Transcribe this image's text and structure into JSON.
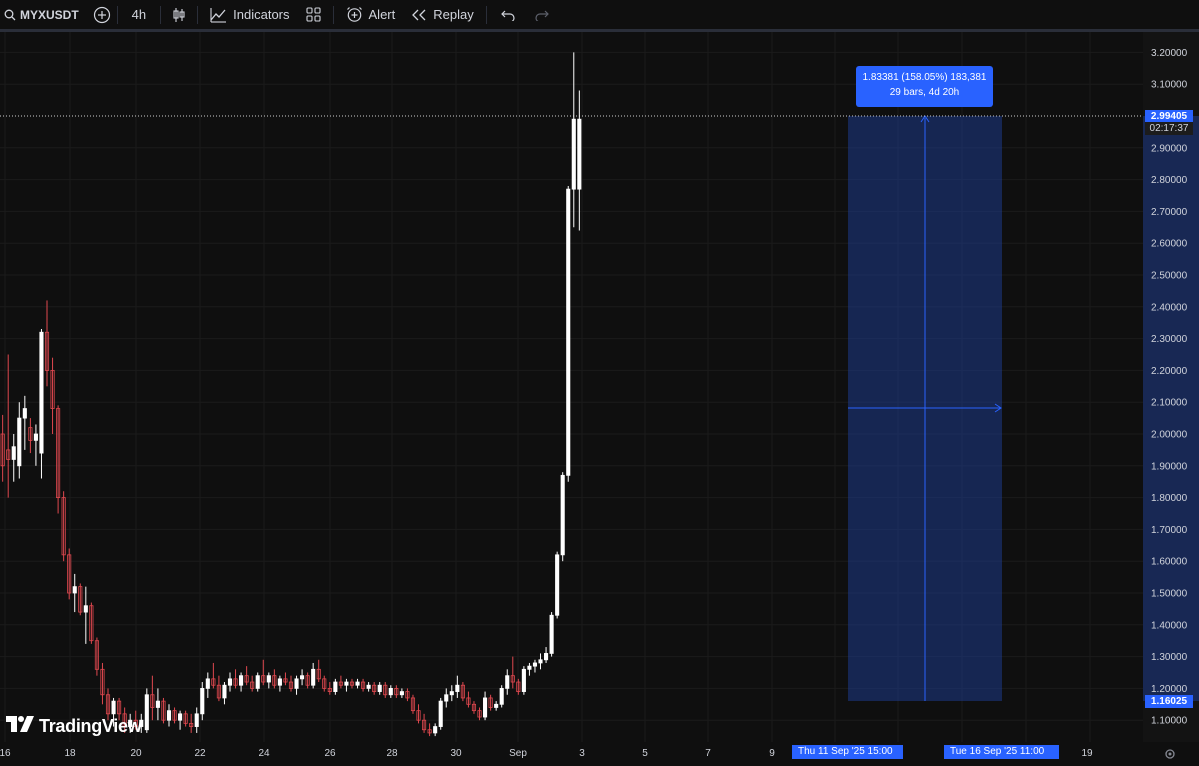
{
  "toolbar": {
    "symbol": "MYXUSDT",
    "interval": "4h",
    "indicators_label": "Indicators",
    "alert_label": "Alert",
    "replay_label": "Replay"
  },
  "colors": {
    "background": "#0f0f0f",
    "up_candle": "#ffffff",
    "down_candle": "#e0484f",
    "measure_fill": "#1e3a8a",
    "accent": "#2962ff"
  },
  "price_axis": {
    "ticks": [
      "3.20000",
      "3.10000",
      "2.90000",
      "2.80000",
      "2.70000",
      "2.60000",
      "2.50000",
      "2.40000",
      "2.30000",
      "2.20000",
      "2.10000",
      "2.00000",
      "1.90000",
      "1.80000",
      "1.70000",
      "1.60000",
      "1.50000",
      "1.40000",
      "1.30000",
      "1.20000",
      "1.10000"
    ],
    "current_price": "2.99405",
    "countdown": "02:17:37",
    "range_low_price": "1.16025"
  },
  "time_axis": {
    "ticks": [
      "16",
      "18",
      "20",
      "22",
      "24",
      "26",
      "28",
      "30",
      "Sep",
      "3",
      "5",
      "7",
      "9",
      "19"
    ],
    "start_label": "Thu 11 Sep '25   15:00",
    "end_label": "Tue 16 Sep '25   11:00"
  },
  "measurement": {
    "line1": "1.83381 (158.05%) 183,381",
    "line2": "29 bars, 4d 20h"
  },
  "branding": {
    "logo_text": "TradingView"
  },
  "chart_data": {
    "type": "candlestick",
    "interval": "4h",
    "ylim": [
      1.06,
      3.26
    ],
    "candles": [
      {
        "o": 2.0,
        "h": 2.06,
        "l": 1.85,
        "c": 1.9
      },
      {
        "o": 1.95,
        "h": 2.25,
        "l": 1.8,
        "c": 1.92
      },
      {
        "o": 1.92,
        "h": 2.0,
        "l": 1.85,
        "c": 1.96
      },
      {
        "o": 1.9,
        "h": 2.1,
        "l": 1.86,
        "c": 2.05
      },
      {
        "o": 2.05,
        "h": 2.12,
        "l": 1.95,
        "c": 2.08
      },
      {
        "o": 2.02,
        "h": 2.05,
        "l": 1.94,
        "c": 1.98
      },
      {
        "o": 1.98,
        "h": 2.03,
        "l": 1.9,
        "c": 2.0
      },
      {
        "o": 1.94,
        "h": 2.33,
        "l": 1.86,
        "c": 2.32
      },
      {
        "o": 2.32,
        "h": 2.42,
        "l": 2.15,
        "c": 2.2
      },
      {
        "o": 2.2,
        "h": 2.24,
        "l": 2.0,
        "c": 2.08
      },
      {
        "o": 2.08,
        "h": 2.09,
        "l": 1.75,
        "c": 1.8
      },
      {
        "o": 1.8,
        "h": 1.82,
        "l": 1.6,
        "c": 1.62
      },
      {
        "o": 1.62,
        "h": 1.64,
        "l": 1.48,
        "c": 1.5
      },
      {
        "o": 1.5,
        "h": 1.56,
        "l": 1.44,
        "c": 1.52
      },
      {
        "o": 1.52,
        "h": 1.53,
        "l": 1.43,
        "c": 1.44
      },
      {
        "o": 1.44,
        "h": 1.52,
        "l": 1.34,
        "c": 1.46
      },
      {
        "o": 1.46,
        "h": 1.47,
        "l": 1.34,
        "c": 1.35
      },
      {
        "o": 1.35,
        "h": 1.36,
        "l": 1.24,
        "c": 1.26
      },
      {
        "o": 1.26,
        "h": 1.28,
        "l": 1.15,
        "c": 1.18
      },
      {
        "o": 1.18,
        "h": 1.2,
        "l": 1.1,
        "c": 1.12
      },
      {
        "o": 1.12,
        "h": 1.17,
        "l": 1.08,
        "c": 1.16
      },
      {
        "o": 1.16,
        "h": 1.17,
        "l": 1.1,
        "c": 1.12
      },
      {
        "o": 1.12,
        "h": 1.14,
        "l": 1.06,
        "c": 1.08
      },
      {
        "o": 1.08,
        "h": 1.12,
        "l": 1.06,
        "c": 1.1
      },
      {
        "o": 1.1,
        "h": 1.13,
        "l": 1.07,
        "c": 1.08
      },
      {
        "o": 1.08,
        "h": 1.12,
        "l": 1.06,
        "c": 1.1
      },
      {
        "o": 1.07,
        "h": 1.2,
        "l": 1.06,
        "c": 1.18
      },
      {
        "o": 1.18,
        "h": 1.24,
        "l": 1.1,
        "c": 1.14
      },
      {
        "o": 1.14,
        "h": 1.2,
        "l": 1.1,
        "c": 1.16
      },
      {
        "o": 1.16,
        "h": 1.17,
        "l": 1.09,
        "c": 1.1
      },
      {
        "o": 1.1,
        "h": 1.15,
        "l": 1.08,
        "c": 1.13
      },
      {
        "o": 1.13,
        "h": 1.14,
        "l": 1.09,
        "c": 1.1
      },
      {
        "o": 1.1,
        "h": 1.13,
        "l": 1.07,
        "c": 1.12
      },
      {
        "o": 1.12,
        "h": 1.13,
        "l": 1.08,
        "c": 1.09
      },
      {
        "o": 1.09,
        "h": 1.12,
        "l": 1.06,
        "c": 1.08
      },
      {
        "o": 1.08,
        "h": 1.14,
        "l": 1.06,
        "c": 1.12
      },
      {
        "o": 1.12,
        "h": 1.22,
        "l": 1.1,
        "c": 1.2
      },
      {
        "o": 1.2,
        "h": 1.25,
        "l": 1.17,
        "c": 1.23
      },
      {
        "o": 1.23,
        "h": 1.28,
        "l": 1.2,
        "c": 1.21
      },
      {
        "o": 1.21,
        "h": 1.24,
        "l": 1.16,
        "c": 1.17
      },
      {
        "o": 1.17,
        "h": 1.22,
        "l": 1.15,
        "c": 1.21
      },
      {
        "o": 1.21,
        "h": 1.25,
        "l": 1.19,
        "c": 1.23
      },
      {
        "o": 1.23,
        "h": 1.26,
        "l": 1.2,
        "c": 1.21
      },
      {
        "o": 1.21,
        "h": 1.25,
        "l": 1.19,
        "c": 1.24
      },
      {
        "o": 1.24,
        "h": 1.27,
        "l": 1.21,
        "c": 1.22
      },
      {
        "o": 1.22,
        "h": 1.24,
        "l": 1.19,
        "c": 1.2
      },
      {
        "o": 1.2,
        "h": 1.25,
        "l": 1.19,
        "c": 1.24
      },
      {
        "o": 1.24,
        "h": 1.29,
        "l": 1.21,
        "c": 1.22
      },
      {
        "o": 1.22,
        "h": 1.25,
        "l": 1.2,
        "c": 1.24
      },
      {
        "o": 1.24,
        "h": 1.26,
        "l": 1.2,
        "c": 1.21
      },
      {
        "o": 1.21,
        "h": 1.24,
        "l": 1.19,
        "c": 1.23
      },
      {
        "o": 1.23,
        "h": 1.25,
        "l": 1.21,
        "c": 1.22
      },
      {
        "o": 1.22,
        "h": 1.24,
        "l": 1.19,
        "c": 1.2
      },
      {
        "o": 1.2,
        "h": 1.24,
        "l": 1.18,
        "c": 1.23
      },
      {
        "o": 1.23,
        "h": 1.26,
        "l": 1.21,
        "c": 1.24
      },
      {
        "o": 1.24,
        "h": 1.25,
        "l": 1.2,
        "c": 1.21
      },
      {
        "o": 1.21,
        "h": 1.28,
        "l": 1.2,
        "c": 1.26
      },
      {
        "o": 1.26,
        "h": 1.29,
        "l": 1.22,
        "c": 1.23
      },
      {
        "o": 1.23,
        "h": 1.24,
        "l": 1.19,
        "c": 1.2
      },
      {
        "o": 1.2,
        "h": 1.22,
        "l": 1.18,
        "c": 1.19
      },
      {
        "o": 1.19,
        "h": 1.23,
        "l": 1.18,
        "c": 1.22
      },
      {
        "o": 1.22,
        "h": 1.24,
        "l": 1.2,
        "c": 1.21
      },
      {
        "o": 1.21,
        "h": 1.23,
        "l": 1.19,
        "c": 1.22
      },
      {
        "o": 1.22,
        "h": 1.23,
        "l": 1.2,
        "c": 1.21
      },
      {
        "o": 1.21,
        "h": 1.23,
        "l": 1.2,
        "c": 1.22
      },
      {
        "o": 1.22,
        "h": 1.23,
        "l": 1.19,
        "c": 1.2
      },
      {
        "o": 1.2,
        "h": 1.22,
        "l": 1.19,
        "c": 1.21
      },
      {
        "o": 1.21,
        "h": 1.22,
        "l": 1.18,
        "c": 1.19
      },
      {
        "o": 1.19,
        "h": 1.22,
        "l": 1.18,
        "c": 1.21
      },
      {
        "o": 1.21,
        "h": 1.22,
        "l": 1.17,
        "c": 1.18
      },
      {
        "o": 1.18,
        "h": 1.21,
        "l": 1.17,
        "c": 1.2
      },
      {
        "o": 1.2,
        "h": 1.21,
        "l": 1.17,
        "c": 1.18
      },
      {
        "o": 1.18,
        "h": 1.2,
        "l": 1.17,
        "c": 1.19
      },
      {
        "o": 1.19,
        "h": 1.2,
        "l": 1.16,
        "c": 1.17
      },
      {
        "o": 1.17,
        "h": 1.18,
        "l": 1.12,
        "c": 1.13
      },
      {
        "o": 1.13,
        "h": 1.15,
        "l": 1.09,
        "c": 1.1
      },
      {
        "o": 1.1,
        "h": 1.12,
        "l": 1.06,
        "c": 1.07
      },
      {
        "o": 1.07,
        "h": 1.09,
        "l": 1.05,
        "c": 1.06
      },
      {
        "o": 1.06,
        "h": 1.09,
        "l": 1.05,
        "c": 1.08
      },
      {
        "o": 1.08,
        "h": 1.17,
        "l": 1.07,
        "c": 1.16
      },
      {
        "o": 1.16,
        "h": 1.2,
        "l": 1.14,
        "c": 1.18
      },
      {
        "o": 1.18,
        "h": 1.21,
        "l": 1.16,
        "c": 1.19
      },
      {
        "o": 1.19,
        "h": 1.24,
        "l": 1.17,
        "c": 1.21
      },
      {
        "o": 1.21,
        "h": 1.22,
        "l": 1.16,
        "c": 1.17
      },
      {
        "o": 1.17,
        "h": 1.19,
        "l": 1.14,
        "c": 1.15
      },
      {
        "o": 1.15,
        "h": 1.16,
        "l": 1.12,
        "c": 1.13
      },
      {
        "o": 1.13,
        "h": 1.14,
        "l": 1.1,
        "c": 1.11
      },
      {
        "o": 1.11,
        "h": 1.19,
        "l": 1.1,
        "c": 1.17
      },
      {
        "o": 1.17,
        "h": 1.18,
        "l": 1.13,
        "c": 1.14
      },
      {
        "o": 1.14,
        "h": 1.16,
        "l": 1.13,
        "c": 1.15
      },
      {
        "o": 1.15,
        "h": 1.21,
        "l": 1.14,
        "c": 1.2
      },
      {
        "o": 1.2,
        "h": 1.26,
        "l": 1.18,
        "c": 1.24
      },
      {
        "o": 1.24,
        "h": 1.3,
        "l": 1.2,
        "c": 1.22
      },
      {
        "o": 1.22,
        "h": 1.23,
        "l": 1.18,
        "c": 1.19
      },
      {
        "o": 1.19,
        "h": 1.27,
        "l": 1.18,
        "c": 1.26
      },
      {
        "o": 1.26,
        "h": 1.28,
        "l": 1.24,
        "c": 1.27
      },
      {
        "o": 1.27,
        "h": 1.29,
        "l": 1.25,
        "c": 1.28
      },
      {
        "o": 1.28,
        "h": 1.31,
        "l": 1.26,
        "c": 1.29
      },
      {
        "o": 1.29,
        "h": 1.33,
        "l": 1.28,
        "c": 1.31
      },
      {
        "o": 1.31,
        "h": 1.44,
        "l": 1.3,
        "c": 1.43
      },
      {
        "o": 1.43,
        "h": 1.63,
        "l": 1.42,
        "c": 1.62
      },
      {
        "o": 1.62,
        "h": 1.88,
        "l": 1.6,
        "c": 1.87
      },
      {
        "o": 1.87,
        "h": 2.78,
        "l": 1.85,
        "c": 2.77
      },
      {
        "o": 2.77,
        "h": 3.2,
        "l": 2.65,
        "c": 2.99
      },
      {
        "o": 2.77,
        "h": 3.08,
        "l": 2.64,
        "c": 2.99
      }
    ],
    "current_price": 2.99405,
    "measure": {
      "from_price": 1.16025,
      "to_price": 2.99405,
      "change": 1.83381,
      "change_pct": 158.05,
      "bars": 29
    }
  }
}
